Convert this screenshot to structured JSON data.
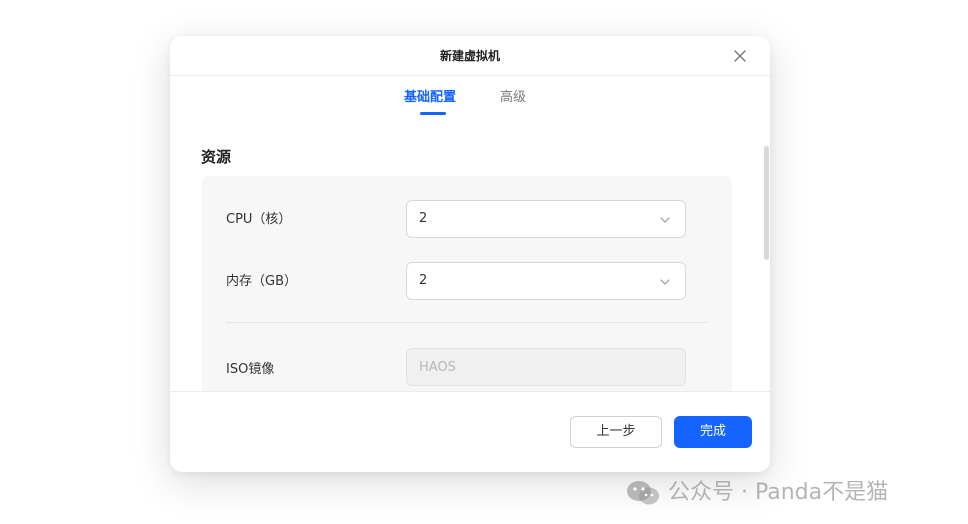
{
  "dialog": {
    "title": "新建虚拟机",
    "close_icon": "close-icon"
  },
  "tabs": [
    {
      "label": "基础配置",
      "active": true
    },
    {
      "label": "高级",
      "active": false
    }
  ],
  "section": {
    "title": "资源",
    "cpu": {
      "label": "CPU（核）",
      "value": "2"
    },
    "memory": {
      "label": "内存（GB）",
      "value": "2"
    },
    "iso": {
      "label": "ISO镜像",
      "value": "HAOS"
    }
  },
  "footer": {
    "prev_label": "上一步",
    "done_label": "完成"
  },
  "watermark": {
    "text": "公众号 · Panda不是猫",
    "icon": "wechat-icon"
  },
  "colors": {
    "accent": "#1664ff"
  }
}
